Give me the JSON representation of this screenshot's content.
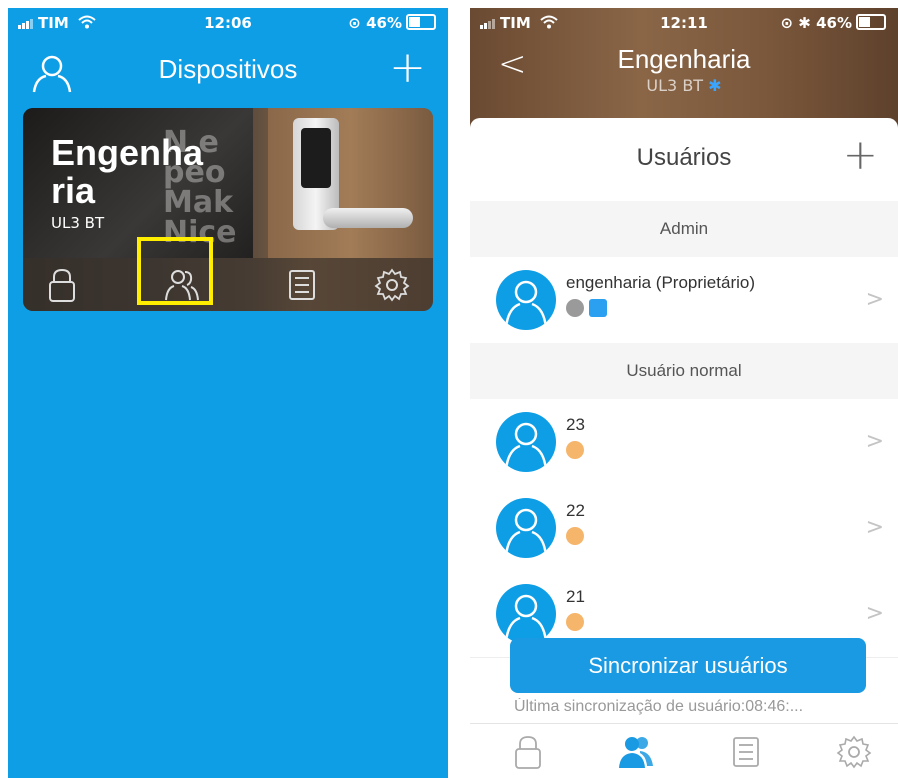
{
  "left": {
    "status": {
      "carrier": "TIM",
      "time": "12:06",
      "battery": "46%"
    },
    "nav": {
      "title": "Dispositivos",
      "plus": "+"
    },
    "device_card": {
      "name_line1": "Engenha",
      "name_line2": "ria",
      "model": "UL3 BT",
      "poster_text": "Nee\npeop\nMak\nNice\nbi"
    }
  },
  "right": {
    "status": {
      "carrier": "TIM",
      "time": "12:11",
      "battery": "46%"
    },
    "header": {
      "back": "<",
      "title": "Engenharia",
      "subtitle": "UL3 BT"
    },
    "sheet": {
      "title": "Usuários",
      "plus": "+",
      "sections": [
        {
          "label": "Admin",
          "users": [
            {
              "name": "engenharia (Proprietário)"
            }
          ]
        },
        {
          "label": "Usuário normal",
          "users": [
            {
              "name": "23"
            },
            {
              "name": "22"
            },
            {
              "name": "21"
            }
          ]
        }
      ],
      "chevron": ">"
    },
    "sync_button": "Sincronizar usuários",
    "sync_info": "Última sincronização de usuário:08:46:..."
  },
  "colors": {
    "primary_blue": "#0e9ee6",
    "highlight": "#ffee00",
    "badge_orange": "#f5b56a"
  }
}
